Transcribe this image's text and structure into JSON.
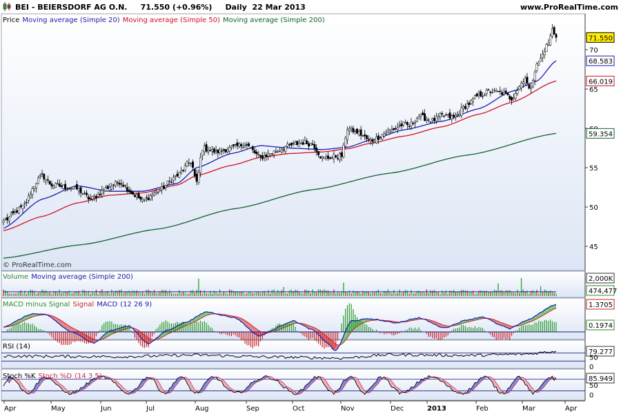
{
  "header": {
    "title": "BEI - BEIERSDORF AG O.N.",
    "last": "71.550",
    "change": "(+0.96%)",
    "period": "Daily",
    "date": "22 Mar 2013",
    "site": "www.ProRealTime.com"
  },
  "colors": {
    "sma20": "#1a1aaa",
    "sma50": "#d01020",
    "sma200": "#106030",
    "panel_bg_top": "#ffffff",
    "panel_bg_bottom": "#dde6f5",
    "volume": "#33aa33"
  },
  "chart_data": [
    {
      "type": "candlestick",
      "panel": "price",
      "legend": {
        "price": "Price",
        "ma20": "Moving average (Simple 20)",
        "ma50": "Moving average (Simple 50)",
        "ma200": "Moving average (Simple 200)"
      },
      "watermark": "© ProRealTime.com",
      "x_tick_labels": [
        "Apr",
        "May",
        "Jun",
        "Jul",
        "Aug",
        "Sep",
        "Oct",
        "Nov",
        "Dec",
        "2013",
        "Feb",
        "Mar",
        "Apr"
      ],
      "y_ticks": [
        45,
        50,
        55,
        60,
        65,
        70
      ],
      "y_range": [
        42.5,
        74
      ],
      "value_tags": [
        {
          "text": "71.550",
          "value": 71.55,
          "series": "price"
        },
        {
          "text": "68.583",
          "value": 68.583,
          "series": "ma20"
        },
        {
          "text": "66.019",
          "value": 66.019,
          "series": "ma50"
        },
        {
          "text": "59.354",
          "value": 59.354,
          "series": "ma200"
        }
      ],
      "close_keypoints": [
        [
          0,
          48.2
        ],
        [
          10,
          50.0
        ],
        [
          18,
          53.5
        ],
        [
          20,
          54.0
        ],
        [
          25,
          52.8
        ],
        [
          38,
          52.3
        ],
        [
          45,
          51.0
        ],
        [
          55,
          52.6
        ],
        [
          60,
          53.2
        ],
        [
          68,
          51.5
        ],
        [
          72,
          50.8
        ],
        [
          80,
          52.0
        ],
        [
          90,
          54.0
        ],
        [
          97,
          55.8
        ],
        [
          100,
          53.0
        ],
        [
          103,
          57.5
        ],
        [
          110,
          57.0
        ],
        [
          118,
          57.5
        ],
        [
          125,
          58.0
        ],
        [
          133,
          56.3
        ],
        [
          140,
          57.0
        ],
        [
          148,
          57.8
        ],
        [
          155,
          58.2
        ],
        [
          160,
          58.0
        ],
        [
          165,
          56.2
        ],
        [
          175,
          56.5
        ],
        [
          178,
          60.0
        ],
        [
          183,
          59.5
        ],
        [
          190,
          58.4
        ],
        [
          200,
          59.7
        ],
        [
          207,
          60.5
        ],
        [
          210,
          60.3
        ],
        [
          215,
          61.5
        ],
        [
          222,
          61.0
        ],
        [
          227,
          61.6
        ],
        [
          233,
          61.4
        ],
        [
          240,
          63.0
        ],
        [
          246,
          64.2
        ],
        [
          252,
          64.7
        ],
        [
          258,
          64.5
        ],
        [
          263,
          63.8
        ],
        [
          265,
          64.6
        ],
        [
          270,
          66.5
        ],
        [
          272,
          64.8
        ],
        [
          276,
          68.0
        ],
        [
          282,
          70.8
        ],
        [
          284,
          72.6
        ],
        [
          286,
          71.55
        ]
      ],
      "ma20_keypoints": [
        [
          0,
          47.3
        ],
        [
          20,
          51.0
        ],
        [
          38,
          52.7
        ],
        [
          55,
          52.0
        ],
        [
          72,
          52.0
        ],
        [
          90,
          53.0
        ],
        [
          100,
          55.0
        ],
        [
          118,
          56.8
        ],
        [
          133,
          57.8
        ],
        [
          148,
          57.5
        ],
        [
          165,
          57.3
        ],
        [
          178,
          57.6
        ],
        [
          190,
          58.5
        ],
        [
          207,
          59.8
        ],
        [
          227,
          60.9
        ],
        [
          246,
          62.5
        ],
        [
          263,
          64.7
        ],
        [
          276,
          66.0
        ],
        [
          286,
          68.583
        ]
      ],
      "ma50_keypoints": [
        [
          0,
          47.0
        ],
        [
          20,
          48.8
        ],
        [
          38,
          50.5
        ],
        [
          55,
          51.5
        ],
        [
          72,
          51.8
        ],
        [
          90,
          52.8
        ],
        [
          100,
          54.0
        ],
        [
          118,
          55.3
        ],
        [
          133,
          56.3
        ],
        [
          148,
          56.8
        ],
        [
          165,
          57.0
        ],
        [
          178,
          57.4
        ],
        [
          190,
          58.1
        ],
        [
          207,
          59.0
        ],
        [
          227,
          60.2
        ],
        [
          246,
          61.8
        ],
        [
          263,
          63.3
        ],
        [
          286,
          66.019
        ]
      ],
      "ma200_keypoints": [
        [
          0,
          43.5
        ],
        [
          40,
          45.2
        ],
        [
          80,
          47.2
        ],
        [
          120,
          49.8
        ],
        [
          160,
          52.2
        ],
        [
          200,
          54.3
        ],
        [
          240,
          56.6
        ],
        [
          286,
          59.354
        ]
      ]
    },
    {
      "type": "bar",
      "panel": "volume",
      "legend": {
        "volume": "Volume",
        "ma": "Moving average (Simple 200)"
      },
      "value_tags": [
        {
          "text": "2,000K",
          "value": 2000000
        },
        {
          "text": "474,477",
          "value": 474477
        }
      ],
      "y_range": [
        0,
        2200000
      ],
      "ma_value": 474477,
      "spikes": [
        [
          101,
          1950000
        ],
        [
          145,
          1000000
        ],
        [
          176,
          1500000
        ],
        [
          256,
          1400000
        ],
        [
          268,
          2000000
        ],
        [
          278,
          1100000
        ]
      ]
    },
    {
      "type": "area",
      "panel": "macd",
      "legend": {
        "hist": "MACD minus Signal",
        "signal": "Signal",
        "macd": "MACD",
        "params": "(12 26 9)"
      },
      "value_tags": [
        {
          "text": "1.3705",
          "value": 1.3705,
          "series": "macd"
        },
        {
          "text": "0.1974",
          "value": 0.1974,
          "series": "hist"
        }
      ],
      "y_range": [
        -1.1,
        1.7
      ],
      "macd_keypoints": [
        [
          0,
          0.25
        ],
        [
          15,
          0.9
        ],
        [
          22,
          0.85
        ],
        [
          35,
          0.0
        ],
        [
          47,
          -0.55
        ],
        [
          55,
          0.05
        ],
        [
          65,
          0.3
        ],
        [
          75,
          -0.6
        ],
        [
          85,
          0.1
        ],
        [
          95,
          0.5
        ],
        [
          105,
          1.0
        ],
        [
          120,
          0.7
        ],
        [
          132,
          -0.2
        ],
        [
          150,
          0.55
        ],
        [
          160,
          0.1
        ],
        [
          167,
          -0.5
        ],
        [
          172,
          -0.95
        ],
        [
          180,
          0.55
        ],
        [
          190,
          0.65
        ],
        [
          203,
          0.45
        ],
        [
          215,
          0.7
        ],
        [
          228,
          0.2
        ],
        [
          240,
          0.6
        ],
        [
          248,
          0.75
        ],
        [
          258,
          0.3
        ],
        [
          262,
          0.15
        ],
        [
          270,
          0.55
        ],
        [
          286,
          1.3705
        ]
      ],
      "hist_final": 0.1974
    },
    {
      "type": "line",
      "panel": "rsi",
      "legend": {
        "name": "RSI",
        "params": "(14)"
      },
      "value_tags": [
        {
          "text": "79.277",
          "value": 79.277
        },
        {
          "text": "50",
          "value": 50
        },
        {
          "text": "0",
          "value": 0
        }
      ],
      "y_range": [
        0,
        100
      ]
    },
    {
      "type": "line",
      "panel": "stochastic",
      "legend": {
        "k": "Stoch %K",
        "d": "Stoch %D",
        "params": "(14 3 5)"
      },
      "value_tags": [
        {
          "text": "85.949",
          "value": 85.949
        },
        {
          "text": "50",
          "value": 50
        },
        {
          "text": "0",
          "value": 0
        }
      ],
      "y_range": [
        0,
        100
      ]
    }
  ]
}
